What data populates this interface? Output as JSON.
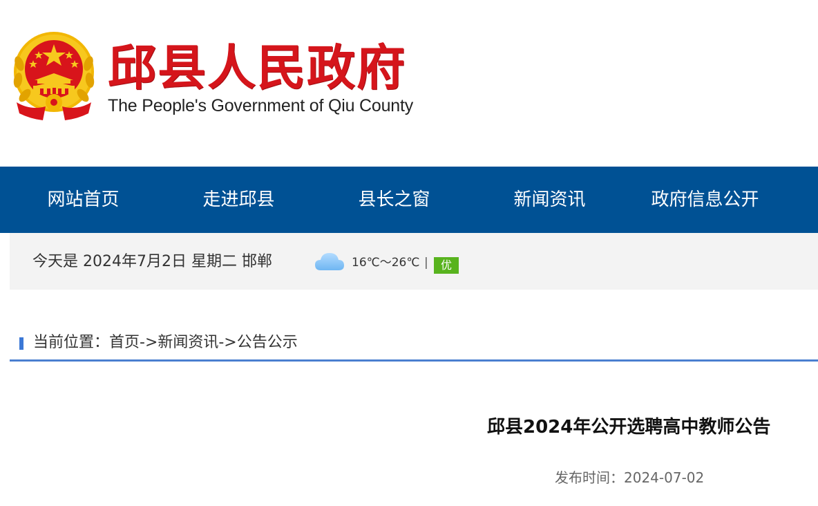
{
  "header": {
    "title": "邱县人民政府",
    "subtitle": "The People's Government of Qiu County",
    "emblem_icon": "national-emblem-icon"
  },
  "nav": {
    "items": [
      {
        "label": "网站首页"
      },
      {
        "label": "走进邱县"
      },
      {
        "label": "县长之窗"
      },
      {
        "label": "新闻资讯"
      },
      {
        "label": "政府信息公开"
      }
    ],
    "background": "#005194"
  },
  "infobar": {
    "date_text": "今天是 2024年7月2日 星期二 邯郸",
    "weather_icon": "cloud-icon",
    "temperature": "16℃～26℃",
    "separator": "|",
    "air_quality": "优"
  },
  "breadcrumb": {
    "text": "当前位置：首页->新闻资讯->公告公示"
  },
  "article": {
    "title": "邱县2024年公开选聘高中教师公告",
    "publish_label": "发布时间：",
    "publish_date": "2024-07-02"
  },
  "colors": {
    "brand_red": "#d5151b",
    "nav_blue": "#005194",
    "accent_blue": "#4a7fd0",
    "aqi_green": "#58b31e"
  }
}
